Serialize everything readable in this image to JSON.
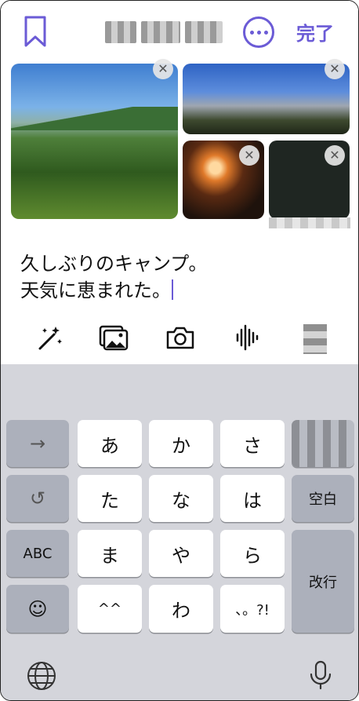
{
  "header": {
    "done_label": "完了",
    "bookmark_icon": "bookmark-icon",
    "more_icon": "ellipsis-circle-icon"
  },
  "note": {
    "line1": "久しぶりのキャンプ。",
    "line2": "天気に恵まれた。"
  },
  "photos": [
    {
      "name": "mountain-forest",
      "remove": "✕"
    },
    {
      "name": "cherry-tree-sky",
      "remove": "✕"
    },
    {
      "name": "campfire-night",
      "remove": "✕"
    },
    {
      "name": "dark-night-sky",
      "remove": "✕"
    }
  ],
  "toolbar": {
    "items": [
      "magic-wand-icon",
      "photo-library-icon",
      "camera-icon",
      "waveform-icon"
    ]
  },
  "keyboard": {
    "rows": [
      [
        "→",
        "あ",
        "か",
        "さ"
      ],
      [
        "↺",
        "た",
        "な",
        "は",
        "空白"
      ],
      [
        "ABC",
        "ま",
        "や",
        "ら",
        "改行"
      ],
      [
        "☺",
        "^^",
        "わ",
        "、。?!"
      ]
    ],
    "bottom": [
      "globe-icon",
      "microphone-icon"
    ]
  },
  "colors": {
    "accent": "#6b5bd6",
    "keyboard_bg": "#d4d5db",
    "key_white": "#ffffff",
    "key_gray": "#acb0bb"
  }
}
